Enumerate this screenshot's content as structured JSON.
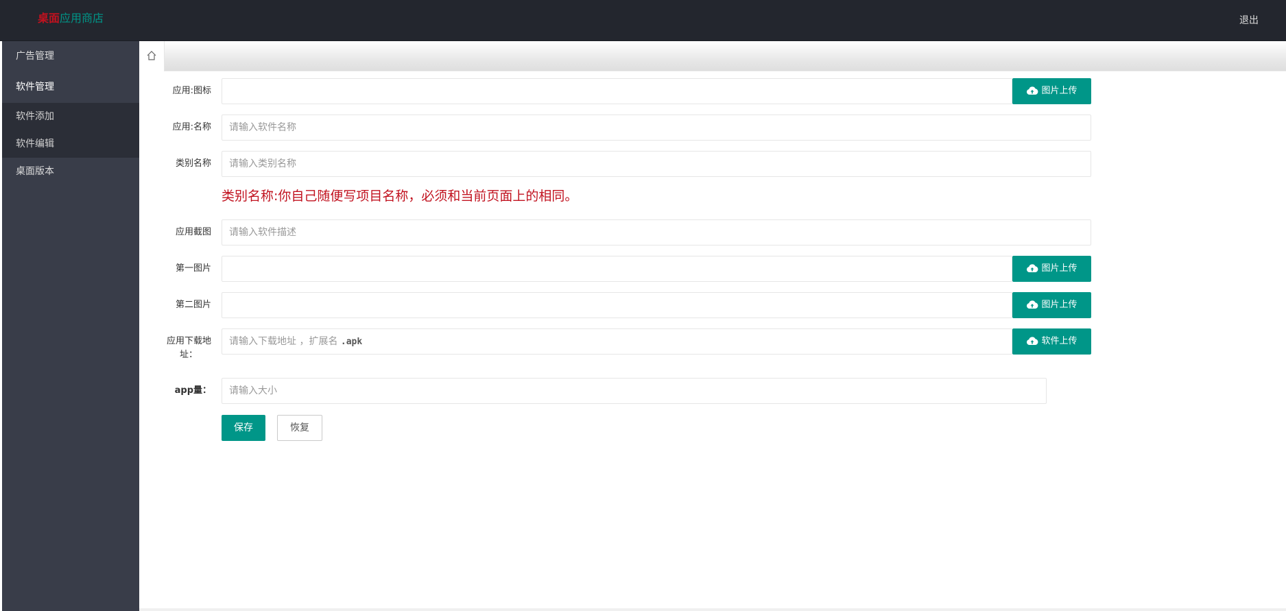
{
  "header": {
    "brand_part1": "桌面",
    "brand_part2": "应用商店",
    "logout_label": "退出"
  },
  "sidebar": {
    "items": [
      {
        "label": "广告管理"
      },
      {
        "label": "软件管理"
      },
      {
        "label": "软件添加"
      },
      {
        "label": "软件编辑"
      },
      {
        "label": "桌面版本"
      }
    ]
  },
  "tabbar": {
    "home_icon": "home-icon"
  },
  "form": {
    "app_icon": {
      "label": "应用:图标",
      "value": "",
      "button": "图片上传"
    },
    "app_name": {
      "label": "应用:名称",
      "placeholder": "请输入软件名称"
    },
    "category": {
      "label": "类别名称",
      "placeholder": "请输入类别名称"
    },
    "hint": "类别名称:你自己随便写项目名称，必须和当前页面上的相同。",
    "screenshot": {
      "label": "应用截图",
      "placeholder": "请输入软件描述"
    },
    "first_image": {
      "label": "第一图片",
      "value": "",
      "button": "图片上传"
    },
    "second_image": {
      "label": "第二图片",
      "value": "",
      "button": "图片上传"
    },
    "download": {
      "label_line1": "应用下载地",
      "label_line2": "址：",
      "placeholder_prefix": "请输入下载地址 ，扩展名 ",
      "placeholder_ext": ".apk",
      "button": "软件上传"
    },
    "size": {
      "label": "app量：",
      "placeholder": "请输入大小"
    },
    "save_label": "保存",
    "reset_label": "恢复"
  },
  "colors": {
    "primary": "#009688",
    "header_bg": "#23262e",
    "sidebar_bg": "#393d49",
    "hint_red": "#c1121f"
  }
}
